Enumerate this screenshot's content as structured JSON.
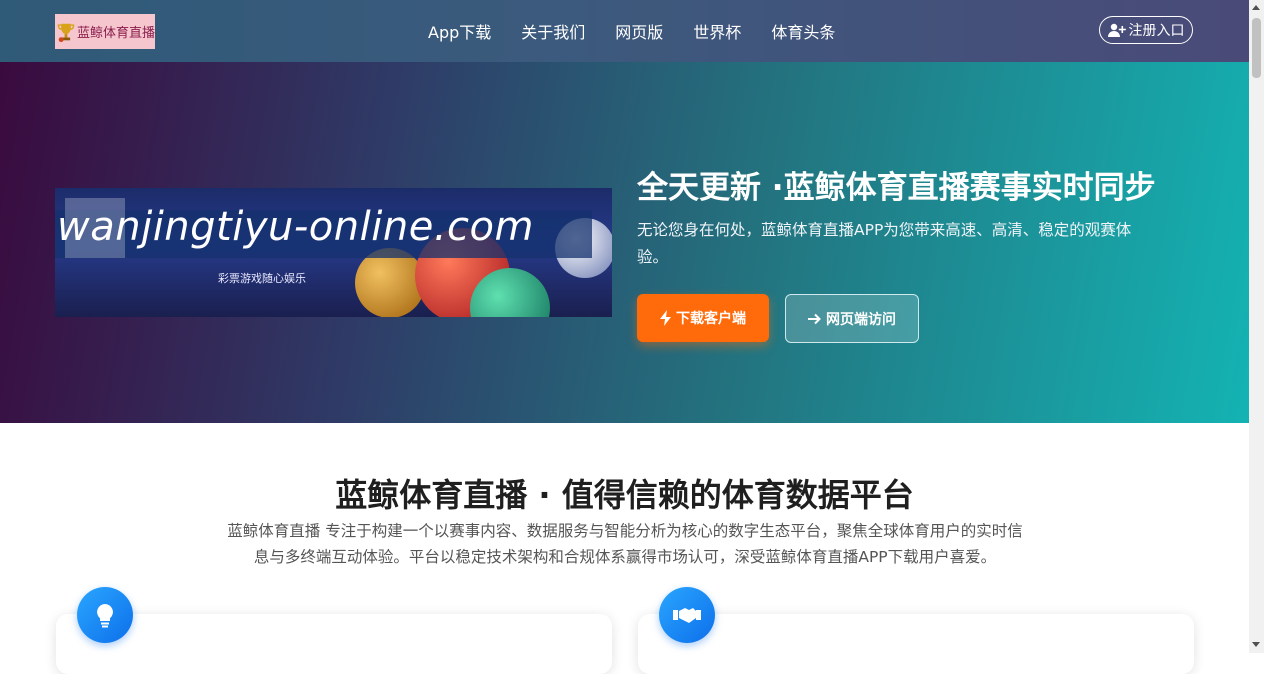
{
  "header": {
    "logo_text": "蓝鲸体育直播",
    "nav": [
      "App下载",
      "关于我们",
      "网页版",
      "世界杯",
      "体育头条"
    ],
    "register_label": "注册入口"
  },
  "hero": {
    "banner_url_text": "wanjingtiyu-online.com",
    "banner_sub_text": "彩票游戏随心娱乐",
    "title": "全天更新 ·蓝鲸体育直播赛事实时同步",
    "description": "无论您身在何处，蓝鲸体育直播APP为您带来高速、高清、稳定的观赛体验。",
    "download_button": "下载客户端",
    "web_button": "网页端访问"
  },
  "about": {
    "title": "蓝鲸体育直播 · 值得信赖的体育数据平台",
    "description": "蓝鲸体育直播 专注于构建一个以赛事内容、数据服务与智能分析为核心的数字生态平台，聚焦全球体育用户的实时信息与多终端互动体验。平台以稳定技术架构和合规体系赢得市场认可，深受蓝鲸体育直播APP下载用户喜爱。"
  },
  "colors": {
    "accent_orange": "#ff6a0a",
    "icon_blue": "#0d6fea"
  },
  "icons": {
    "card1": "lightbulb-icon",
    "card2": "handshake-icon"
  }
}
